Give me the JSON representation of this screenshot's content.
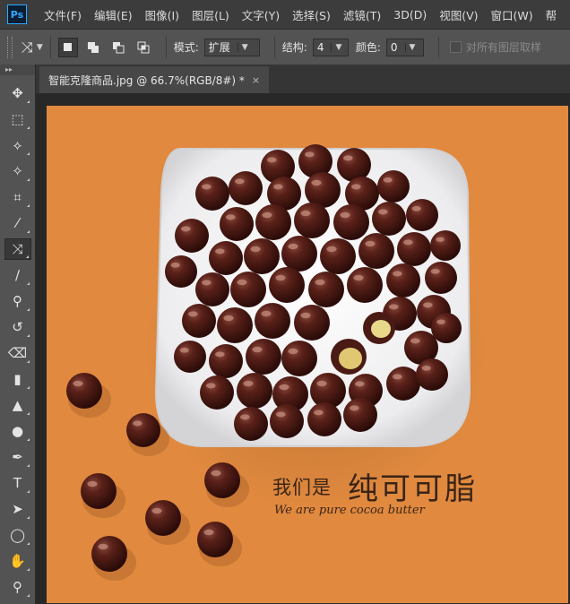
{
  "app": {
    "logo": "Ps"
  },
  "menu": [
    "文件(F)",
    "编辑(E)",
    "图像(I)",
    "图层(L)",
    "文字(Y)",
    "选择(S)",
    "滤镜(T)",
    "3D(D)",
    "视图(V)",
    "窗口(W)",
    "帮"
  ],
  "options": {
    "tool_icon": "content-aware-move-icon",
    "mode_label": "模式:",
    "mode_value": "扩展",
    "structure_label": "结构:",
    "structure_value": "4",
    "color_label": "颜色:",
    "color_value": "0",
    "sample_all_label": "对所有图层取样"
  },
  "tools": [
    {
      "name": "move-tool-icon",
      "glyph": "✥"
    },
    {
      "name": "marquee-tool-icon",
      "glyph": "⬚"
    },
    {
      "name": "lasso-tool-icon",
      "glyph": "⟡"
    },
    {
      "name": "magic-wand-tool-icon",
      "glyph": "✧"
    },
    {
      "name": "crop-tool-icon",
      "glyph": "⌗"
    },
    {
      "name": "eyedropper-tool-icon",
      "glyph": "⁄"
    },
    {
      "name": "content-aware-move-tool-icon",
      "glyph": "⤨",
      "active": true
    },
    {
      "name": "brush-tool-icon",
      "glyph": "∕"
    },
    {
      "name": "clone-stamp-tool-icon",
      "glyph": "⚲"
    },
    {
      "name": "history-brush-tool-icon",
      "glyph": "↺"
    },
    {
      "name": "eraser-tool-icon",
      "glyph": "⌫"
    },
    {
      "name": "gradient-tool-icon",
      "glyph": "▮"
    },
    {
      "name": "blur-tool-icon",
      "glyph": "▲"
    },
    {
      "name": "dodge-tool-icon",
      "glyph": "●"
    },
    {
      "name": "pen-tool-icon",
      "glyph": "✒"
    },
    {
      "name": "type-tool-icon",
      "glyph": "T"
    },
    {
      "name": "path-selection-tool-icon",
      "glyph": "➤"
    },
    {
      "name": "ellipse-tool-icon",
      "glyph": "◯"
    },
    {
      "name": "hand-tool-icon",
      "glyph": "✋"
    },
    {
      "name": "zoom-tool-icon",
      "glyph": "⚲"
    }
  ],
  "document": {
    "tab_title": "智能克隆商品.jpg @ 66.7%(RGB/8#) *",
    "tab_close": "×"
  },
  "artwork": {
    "caption_cn_small": "我们是",
    "caption_cn_large": "纯可可脂",
    "caption_en": "We are pure cocoa butter",
    "background_color": "#e0893f",
    "plate_color": "#f1f1f1",
    "chocolate_color": "#4a1a14"
  }
}
